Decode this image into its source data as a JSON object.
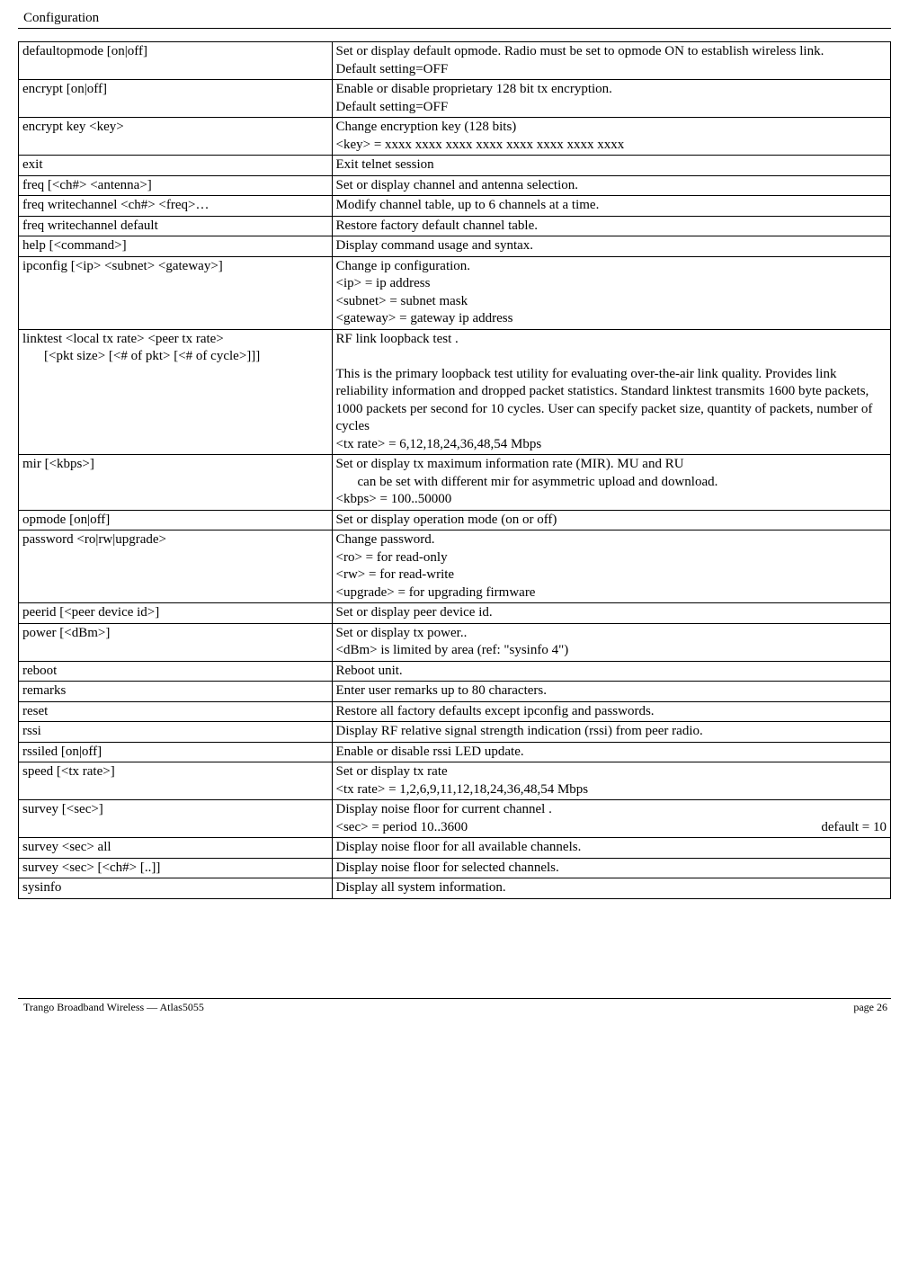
{
  "header": {
    "title": "Configuration"
  },
  "footer": {
    "left": "Trango Broadband Wireless — Atlas5055",
    "right": "page 26"
  },
  "rows": [
    {
      "cmd": "defaultopmode [on|off]",
      "desc": "Set or display default opmode.   Radio must be set to opmode ON to establish wireless link.\nDefault setting=OFF"
    },
    {
      "cmd": "encrypt [on|off]",
      "desc": "Enable or disable proprietary 128 bit tx encryption.\nDefault setting=OFF"
    },
    {
      "cmd": "encrypt key <key>",
      "desc": "Change encryption key (128 bits)\n<key> = xxxx xxxx xxxx xxxx xxxx xxxx xxxx xxxx"
    },
    {
      "cmd": "exit",
      "desc": "Exit telnet session"
    },
    {
      "cmd": "freq [<ch#> <antenna>]",
      "desc": "Set or display channel and antenna selection."
    },
    {
      "cmd": "freq writechannel <ch#> <freq>…",
      "desc": "Modify channel table, up to 6 channels at a time."
    },
    {
      "cmd": "freq writechannel default",
      "desc": "Restore factory default channel table."
    },
    {
      "cmd": "help [<command>]",
      "desc": "Display command usage and syntax."
    },
    {
      "cmd": "ipconfig [<ip> <subnet> <gateway>]",
      "desc": "Change ip configuration.\n<ip> = ip address\n<subnet> = subnet mask\n<gateway> = gateway ip address"
    },
    {
      "cmd_main": "linktest <local tx rate> <peer tx rate>",
      "cmd_sub": "[<pkt size> [<# of pkt> [<# of cycle>]]]",
      "desc": "RF link loopback test .\n\nThis is the primary loopback test utility for evaluating over-the-air link quality.  Provides link reliability information and dropped packet statistics.  Standard linktest transmits 1600 byte packets, 1000 packets per second for 10 cycles.  User can specify packet size, quantity of packets, number of cycles\n<tx rate> = 6,12,18,24,36,48,54 Mbps\n "
    },
    {
      "cmd": "mir [<kbps>]",
      "desc_main": "Set or display tx maximum information rate (MIR).   MU and RU",
      "desc_sub": "can be set with different mir for asymmetric upload and download.",
      "desc_tail": "<kbps> = 100..50000"
    },
    {
      "cmd": "opmode [on|off]",
      "desc": "Set or display operation mode (on or off)"
    },
    {
      "cmd": "password <ro|rw|upgrade>",
      "desc": "Change password.\n<ro> = for read-only\n<rw> = for read-write\n<upgrade> = for upgrading firmware"
    },
    {
      "cmd": "peerid [<peer device id>]",
      "desc": "Set or display peer device id."
    },
    {
      "cmd": "power [<dBm>]",
      "desc": "Set or display tx power..\n<dBm> is limited by area (ref: \"sysinfo 4\")"
    },
    {
      "cmd": "reboot",
      "desc": "Reboot unit."
    },
    {
      "cmd": "remarks",
      "desc": "Enter user remarks up to 80 characters."
    },
    {
      "cmd": "reset",
      "desc": "Restore all factory defaults except ipconfig and passwords."
    },
    {
      "cmd": "rssi",
      "desc": "Display RF relative signal strength indication (rssi) from peer radio."
    },
    {
      "cmd": "rssiled [on|off]",
      "desc": "Enable or disable rssi LED update."
    },
    {
      "cmd": "speed [<tx rate>]",
      "desc": "Set or display tx rate\n<tx rate> = 1,2,6,9,11,12,18,24,36,48,54 Mbps"
    },
    {
      "cmd": "survey [<sec>]",
      "desc_left": "Display noise floor for current channel .\n<sec> = period 10..3600",
      "desc_right": "default = 10"
    },
    {
      "cmd": "survey <sec> all",
      "desc": "Display noise floor for all available channels."
    },
    {
      "cmd": "survey <sec> [<ch#> [..]]",
      "desc": "Display noise floor for selected channels."
    },
    {
      "cmd": "sysinfo",
      "desc": "Display all system information."
    }
  ]
}
